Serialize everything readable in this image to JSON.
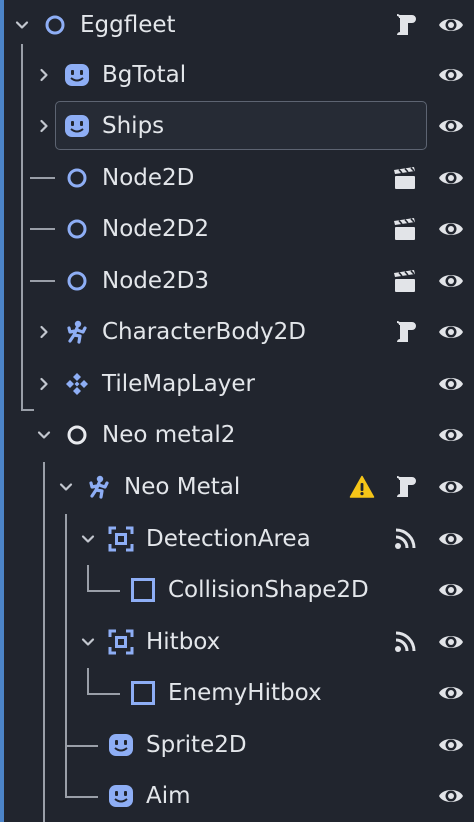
{
  "colors": {
    "background": "#21252e",
    "accent": "#4c84c8",
    "icon_blue": "#8eaef5",
    "guide": "#9a9fa8",
    "warning": "#f5c518"
  },
  "tree": [
    {
      "label": "Eggfleet",
      "node_icon": "node-circle-icon",
      "arrow": "expanded",
      "badges": [
        "script-icon"
      ],
      "selected": false
    },
    {
      "label": "BgTotal",
      "node_icon": "sprite-icon",
      "arrow": "collapsed",
      "badges": [],
      "selected": false
    },
    {
      "label": "Ships",
      "node_icon": "sprite-icon",
      "arrow": "collapsed",
      "badges": [],
      "selected": true
    },
    {
      "label": "Node2D",
      "node_icon": "node-circle-icon",
      "arrow": "none",
      "badges": [
        "scene-clapper-icon"
      ],
      "selected": false
    },
    {
      "label": "Node2D2",
      "node_icon": "node-circle-icon",
      "arrow": "none",
      "badges": [
        "scene-clapper-icon"
      ],
      "selected": false
    },
    {
      "label": "Node2D3",
      "node_icon": "node-circle-icon",
      "arrow": "none",
      "badges": [
        "scene-clapper-icon"
      ],
      "selected": false
    },
    {
      "label": "CharacterBody2D",
      "node_icon": "character-body-icon",
      "arrow": "collapsed",
      "badges": [
        "script-icon"
      ],
      "selected": false
    },
    {
      "label": "TileMapLayer",
      "node_icon": "tilemap-icon",
      "arrow": "collapsed",
      "badges": [],
      "selected": false
    },
    {
      "label": "Neo metal2",
      "node_icon": "node-circle-white-icon",
      "arrow": "expanded",
      "badges": [],
      "selected": false
    },
    {
      "label": "Neo Metal",
      "node_icon": "character-body-icon",
      "arrow": "expanded",
      "badges": [
        "warning-icon",
        "script-icon"
      ],
      "selected": false
    },
    {
      "label": "DetectionArea",
      "node_icon": "area2d-icon",
      "arrow": "expanded",
      "badges": [
        "signal-icon"
      ],
      "selected": false
    },
    {
      "label": "CollisionShape2D",
      "node_icon": "collision-shape-icon",
      "arrow": "none",
      "badges": [],
      "selected": false
    },
    {
      "label": "Hitbox",
      "node_icon": "area2d-icon",
      "arrow": "expanded",
      "badges": [
        "signal-icon"
      ],
      "selected": false
    },
    {
      "label": "EnemyHitbox",
      "node_icon": "collision-shape-icon",
      "arrow": "none",
      "badges": [],
      "selected": false
    },
    {
      "label": "Sprite2D",
      "node_icon": "sprite-icon",
      "arrow": "none",
      "badges": [],
      "selected": false
    },
    {
      "label": "Aim",
      "node_icon": "sprite-icon",
      "arrow": "none",
      "badges": [],
      "selected": false
    }
  ]
}
